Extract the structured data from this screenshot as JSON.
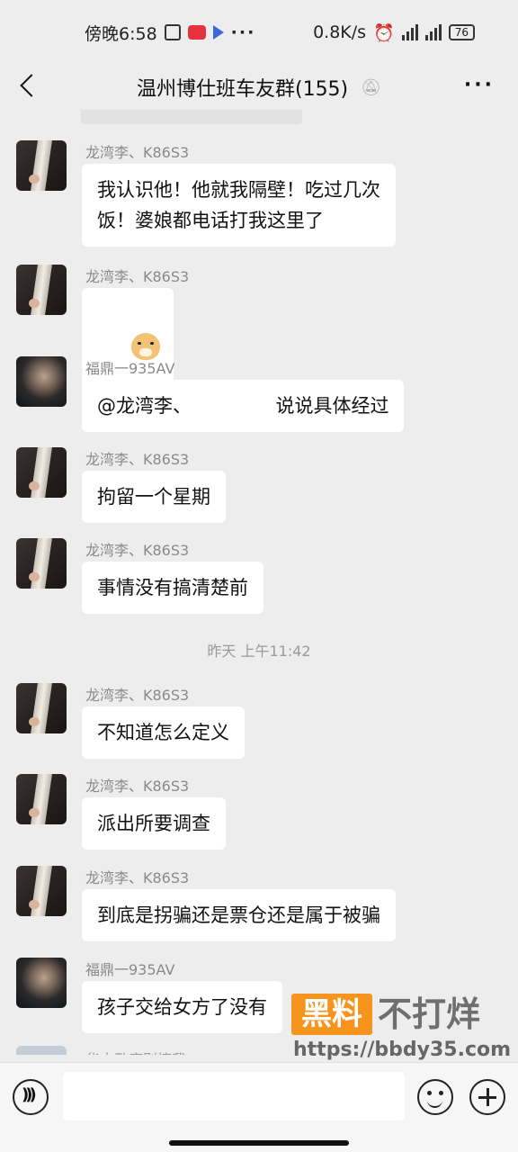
{
  "status_bar": {
    "time": "傍晚6:58",
    "network_speed": "0.8K/s",
    "battery": "76",
    "dots": "···"
  },
  "header": {
    "title": "温州博仕班车友群(155)",
    "more": "···"
  },
  "messages": [
    {
      "sender": "龙湾李、K86S3",
      "text": "我认识他！他就我隔壁！吃过几次\n饭！婆娘都电话打我这里了"
    },
    {
      "sender": "龙湾李、K86S3",
      "text": ""
    },
    {
      "sender": "福鼎一935AV",
      "text": "@龙湾李、              说说具体经过"
    },
    {
      "sender": "龙湾李、K86S3",
      "text": "拘留一个星期"
    },
    {
      "sender": "龙湾李、K86S3",
      "text": "事情没有搞清楚前"
    },
    {
      "sender": "龙湾李、K86S3",
      "text": "不知道怎么定义"
    },
    {
      "sender": "龙湾李、K86S3",
      "text": "派出所要调查"
    },
    {
      "sender": "龙湾李、K86S3",
      "text": "到底是拐骗还是票仓还是属于被骗"
    },
    {
      "sender": "福鼎一935AV",
      "text": "孩子交给女方了没有"
    }
  ],
  "timestamp": "昨天 上午11:42",
  "partial_sender": "华杰卧底别搞我",
  "watermark": {
    "box": "黑料",
    "text": "不打烊",
    "url": "https://bbdy35.com"
  },
  "icons": {
    "back": "back-arrow-icon",
    "mute": "bell-mute-icon",
    "more": "more-dots-icon",
    "voice": "voice-icon",
    "emoji": "emoji-icon",
    "plus": "plus-icon"
  }
}
